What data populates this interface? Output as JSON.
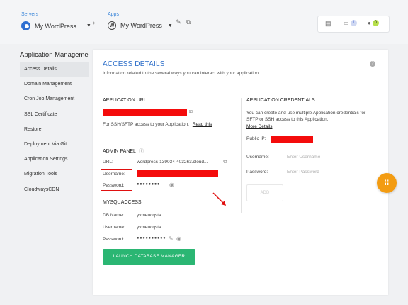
{
  "topbar": {
    "servers_label": "Servers",
    "server_name": "My WordPress",
    "apps_label": "Apps",
    "app_name": "My WordPress",
    "folder_badge": "1",
    "user_badge": "0"
  },
  "sidebar": {
    "title": "Application Management",
    "items": [
      {
        "label": "Access Details"
      },
      {
        "label": "Domain Management"
      },
      {
        "label": "Cron Job Management"
      },
      {
        "label": "SSL Certificate"
      },
      {
        "label": "Restore"
      },
      {
        "label": "Deployment Via Git"
      },
      {
        "label": "Application Settings"
      },
      {
        "label": "Migration Tools"
      },
      {
        "label": "CloudwaysCDN"
      }
    ]
  },
  "main": {
    "title": "ACCESS DETAILS",
    "subtitle": "Information related to the several ways you can interact with your application",
    "app_url": {
      "heading": "APPLICATION URL",
      "sftp_note": "For SSH/SFTP access to your Application.",
      "read_this": "Read this"
    },
    "admin_panel": {
      "heading": "ADMIN PANEL",
      "url_label": "URL:",
      "url_value": "wordpress-139034-403263.cloud...",
      "username_label": "Username:",
      "password_label": "Password:",
      "password_mask": "●●●●●●●●"
    },
    "mysql": {
      "heading": "MYSQL ACCESS",
      "db_name_label": "DB Name:",
      "db_name_value": "yvmeucqsta",
      "username_label": "Username:",
      "username_value": "yvmeucqsta",
      "password_label": "Password:",
      "password_mask": "●●●●●●●●●●",
      "launch_button": "LAUNCH DATABASE MANAGER"
    },
    "credentials": {
      "heading": "APPLICATION CREDENTIALS",
      "description": "You can create and use multiple Application credentials for SFTP or SSH access to this Application.",
      "more_details": "More Details",
      "public_ip_label": "Public IP:",
      "username_label": "Username:",
      "username_placeholder": "Enter Username",
      "password_label": "Password:",
      "password_placeholder": "Enter Password",
      "add_button": "ADD"
    }
  },
  "colors": {
    "accent": "#2c6ec9",
    "launch_green": "#2bb673",
    "redaction": "#f40c0c",
    "fab_orange": "#f39c12"
  }
}
